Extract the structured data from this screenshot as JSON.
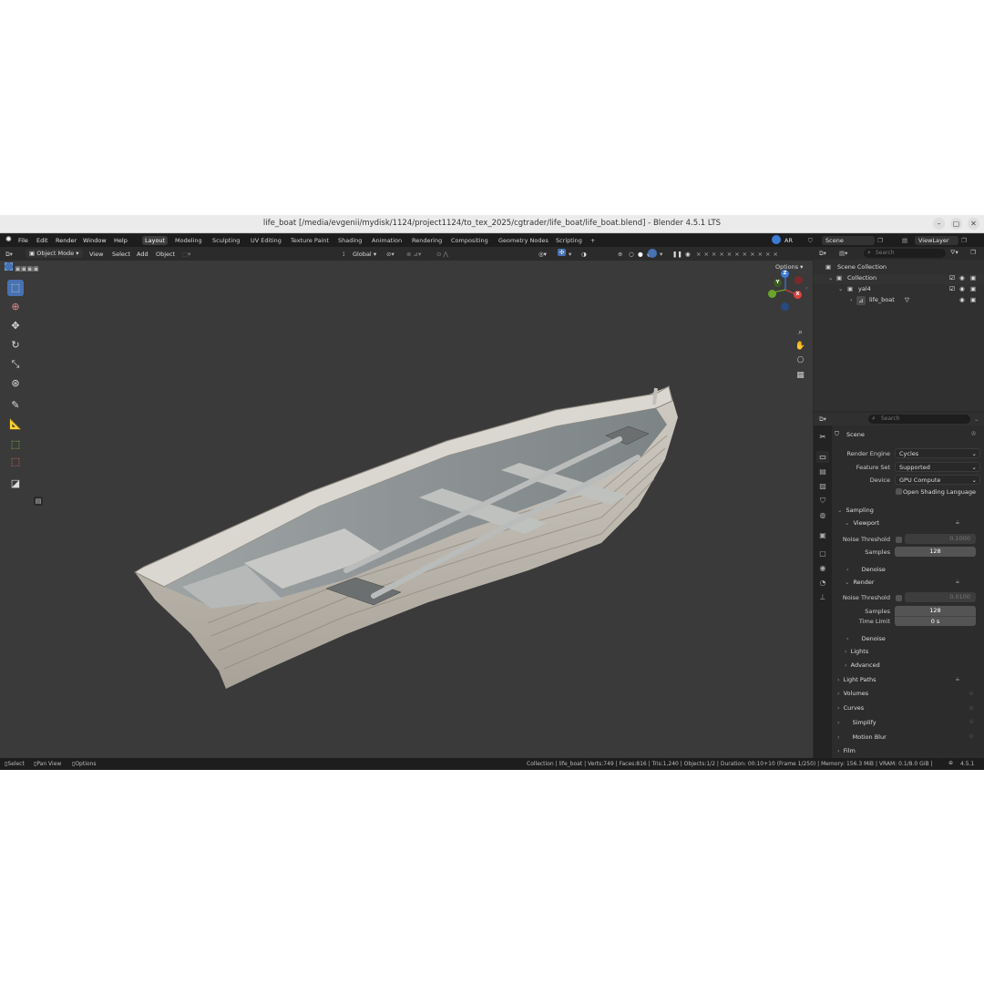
{
  "window": {
    "title": "life_boat [/media/evgenii/mydisk/1124/project1124/to_tex_2025/cgtrader/life_boat/life_boat.blend] - Blender 4.5.1 LTS",
    "minimize": "–",
    "maximize": "▢",
    "close": "✕"
  },
  "menu": {
    "items": [
      "File",
      "Edit",
      "Render",
      "Window",
      "Help"
    ],
    "workspaces": [
      "Layout",
      "Modeling",
      "Sculpting",
      "UV Editing",
      "Texture Paint",
      "Shading",
      "Animation",
      "Rendering",
      "Compositing",
      "Geometry Nodes",
      "Scripting"
    ],
    "add_workspace": "+",
    "ar_label": "AR",
    "scene": "Scene",
    "view_layer": "ViewLayer"
  },
  "viewport_header": {
    "mode": "Object Mode",
    "view": "View",
    "select": "Select",
    "add": "Add",
    "object": "Object",
    "orientation": "Global",
    "options": "Options"
  },
  "gizmo": {
    "x": "X",
    "y": "Y",
    "z": "Z"
  },
  "outliner": {
    "search_placeholder": "Search",
    "rows": [
      {
        "label": "Scene Collection"
      },
      {
        "label": "Collection"
      },
      {
        "label": "yal4"
      },
      {
        "label": "life_boat"
      }
    ]
  },
  "properties": {
    "search_placeholder": "Search",
    "context": "Scene",
    "render_engine_label": "Render Engine",
    "render_engine": "Cycles",
    "feature_set_label": "Feature Set",
    "feature_set": "Supported",
    "device_label": "Device",
    "device": "GPU Compute",
    "osl_label": "Open Shading Language",
    "sampling": "Sampling",
    "viewport": "Viewport",
    "noise_threshold_label": "Noise Threshold",
    "viewport_noise_threshold": "0.1000",
    "samples_label": "Samples",
    "viewport_samples": "128",
    "denoise": "Denoise",
    "render": "Render",
    "render_noise_threshold": "0.0100",
    "render_samples": "128",
    "time_limit_label": "Time Limit",
    "time_limit": "0 s",
    "lights": "Lights",
    "advanced": "Advanced",
    "light_paths": "Light Paths",
    "volumes": "Volumes",
    "curves": "Curves",
    "simplify": "Simplify",
    "motion_blur": "Motion Blur",
    "film": "Film"
  },
  "statusbar": {
    "select": "Select",
    "pan_view": "Pan View",
    "options": "Options",
    "stats": "Collection | life_boat | Verts:749 | Faces:816 | Tris:1,240 | Objects:1/2 | Duration: 00:10+10 (Frame 1/250) | Memory: 156.3 MiB | VRAM: 0.1/8.0 GiB |",
    "version": "4.5.1"
  },
  "colors": {
    "accent": "#4772b3",
    "axis_x": "#e0413f",
    "axis_y": "#6aa52b",
    "axis_z": "#3d7cd6"
  },
  "icons": [
    "blender-logo-icon",
    "select-box-icon",
    "cursor-icon",
    "move-icon",
    "rotate-icon",
    "scale-icon",
    "transform-icon",
    "annotate-icon",
    "measure-icon",
    "add-cube-icon",
    "eye-icon",
    "camera-icon",
    "filter-icon",
    "pin-icon",
    "zoom-icon",
    "hand-icon",
    "camera-view-icon",
    "grid-icon"
  ]
}
